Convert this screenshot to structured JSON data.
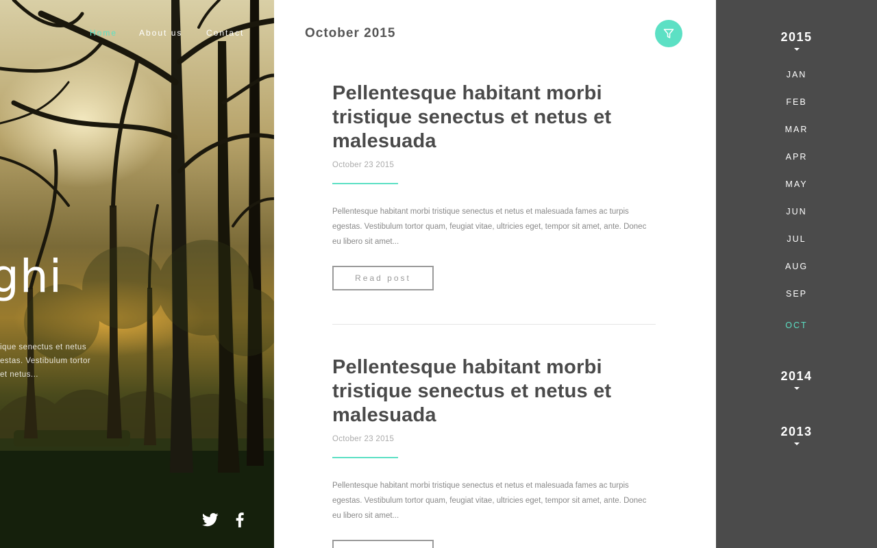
{
  "hero": {
    "nav": [
      {
        "label": "Home",
        "active": true
      },
      {
        "label": "About us",
        "active": false
      },
      {
        "label": "Contact",
        "active": false
      }
    ],
    "title": "ghi",
    "text": "ique senectus et netus\nestas. Vestibulum tortor\net netus...",
    "social": [
      {
        "icon": "twitter-icon"
      },
      {
        "icon": "facebook-icon"
      }
    ]
  },
  "main": {
    "month_title": "October 2015",
    "filter_icon": "filter-icon",
    "posts": [
      {
        "title": "Pellentesque habitant morbi tristique senectus et netus et malesuada",
        "date": "October 23 2015",
        "excerpt": "Pellentesque habitant morbi tristique senectus et netus et malesuada fames ac turpis egestas. Vestibulum tortor quam, feugiat vitae, ultricies eget, tempor sit amet, ante. Donec eu libero sit amet...",
        "button": "Read post"
      },
      {
        "title": "Pellentesque habitant morbi tristique senectus et netus et malesuada",
        "date": "October 23 2015",
        "excerpt": "Pellentesque habitant morbi tristique senectus et netus et malesuada fames ac turpis egestas. Vestibulum tortor quam, feugiat vitae, ultricies eget, tempor sit amet, ante. Donec eu libero sit amet...",
        "button": "Read post"
      }
    ]
  },
  "archive": {
    "years": [
      {
        "label": "2015",
        "expanded": true
      },
      {
        "label": "2014",
        "expanded": false
      },
      {
        "label": "2013",
        "expanded": false
      }
    ],
    "months": [
      {
        "label": "JAN",
        "active": false
      },
      {
        "label": "FEB",
        "active": false
      },
      {
        "label": "MAR",
        "active": false
      },
      {
        "label": "APR",
        "active": false
      },
      {
        "label": "MAY",
        "active": false
      },
      {
        "label": "JUN",
        "active": false
      },
      {
        "label": "JUL",
        "active": false
      },
      {
        "label": "AUG",
        "active": false
      },
      {
        "label": "SEP",
        "active": false
      },
      {
        "label": "OCT",
        "active": true
      }
    ]
  },
  "colors": {
    "accent": "#5ce0c4",
    "sidebar_bg": "#4b4b4b",
    "title_text": "#4a4a4a"
  }
}
